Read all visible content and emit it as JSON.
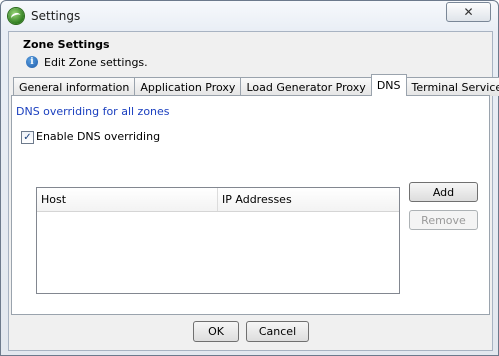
{
  "window": {
    "title": "Settings",
    "close_glyph": "✕"
  },
  "header": {
    "title": "Zone Settings",
    "description": "Edit Zone settings."
  },
  "tabs": [
    {
      "label": "General information",
      "active": false
    },
    {
      "label": "Application Proxy",
      "active": false
    },
    {
      "label": "Load Generator Proxy",
      "active": false
    },
    {
      "label": "DNS",
      "active": true
    },
    {
      "label": "Terminal Services",
      "active": false
    }
  ],
  "dns": {
    "heading": "DNS overriding for all zones",
    "enable_checkbox": {
      "label": "Enable DNS overriding",
      "checked": true,
      "mark": "✓"
    },
    "table": {
      "columns": [
        "Host",
        "IP Addresses"
      ],
      "rows": []
    },
    "add_label": "Add",
    "remove_label": "Remove"
  },
  "footer": {
    "ok_label": "OK",
    "cancel_label": "Cancel"
  },
  "colors": {
    "heading_blue": "#1a3fbf",
    "app_icon_green": "#2f7d1f"
  },
  "icons": {
    "app": "app-logo-icon",
    "info": "info-icon",
    "close": "close-icon",
    "check": "check-icon"
  }
}
